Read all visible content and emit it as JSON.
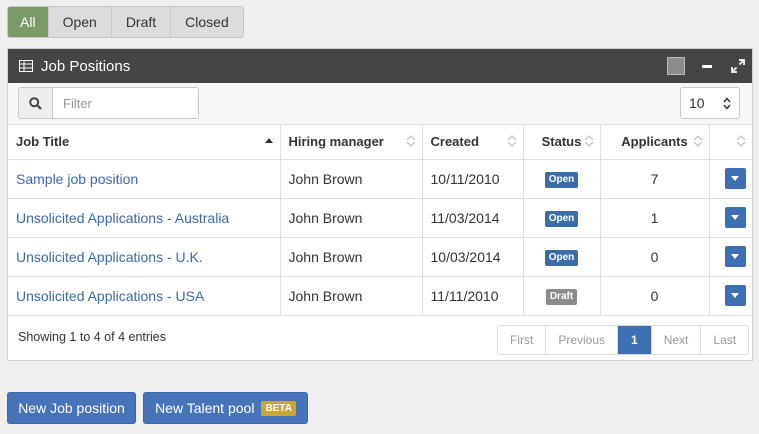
{
  "filters": [
    "All",
    "Open",
    "Draft",
    "Closed"
  ],
  "panel": {
    "title": "Job Positions",
    "filter_placeholder": "Filter",
    "page_size": "10"
  },
  "table": {
    "columns": [
      "Job Title",
      "Hiring manager",
      "Created",
      "Status",
      "Applicants"
    ],
    "rows": [
      {
        "title": "Sample job position",
        "manager": "John Brown",
        "created": "10/11/2010",
        "status": "Open",
        "applicants": "7"
      },
      {
        "title": "Unsolicited Applications - Australia",
        "manager": "John Brown",
        "created": "11/03/2014",
        "status": "Open",
        "applicants": "1"
      },
      {
        "title": "Unsolicited Applications - U.K.",
        "manager": "John Brown",
        "created": "10/03/2014",
        "status": "Open",
        "applicants": "0"
      },
      {
        "title": "Unsolicited Applications - USA",
        "manager": "John Brown",
        "created": "11/11/2010",
        "status": "Draft",
        "applicants": "0"
      }
    ]
  },
  "footer": {
    "showing": "Showing 1 to 4 of 4 entries",
    "pager": [
      "First",
      "Previous",
      "1",
      "Next",
      "Last"
    ]
  },
  "buttons": {
    "new_job": "New Job position",
    "new_talent": "New Talent pool",
    "beta": "BETA"
  },
  "colors": {
    "active_tab": "#7a9a68",
    "primary": "#4774b8",
    "link": "#3b6aa8",
    "header_bar": "#444547",
    "beta": "#c9a636"
  }
}
